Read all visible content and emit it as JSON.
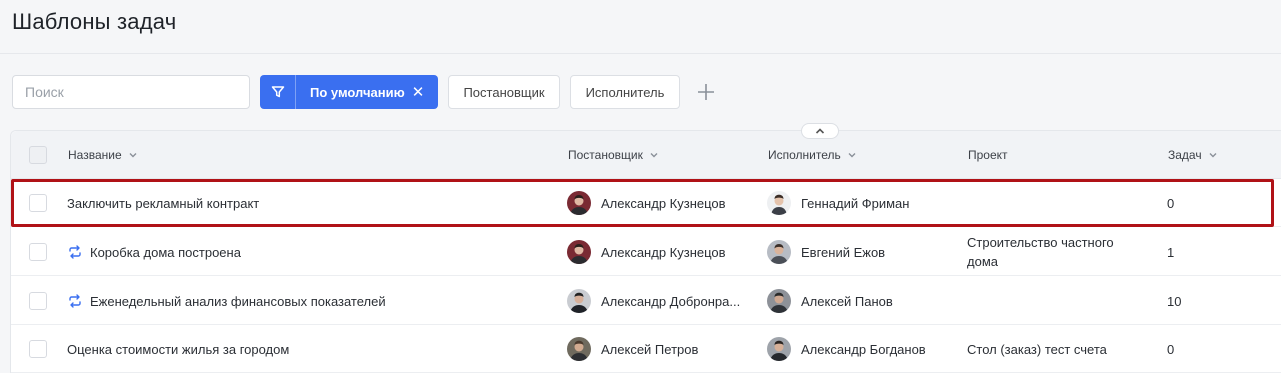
{
  "page": {
    "title": "Шаблоны задач"
  },
  "search": {
    "placeholder": "Поиск",
    "value": ""
  },
  "filters": {
    "default_label": "По умолчанию",
    "author_label": "Постановщик",
    "executor_label": "Исполнитель"
  },
  "table": {
    "columns": {
      "name": "Название",
      "author": "Постановщик",
      "executor": "Исполнитель",
      "project": "Проект",
      "tasks": "Задач"
    },
    "rows": [
      {
        "name": "Заключить рекламный контракт",
        "recurring": false,
        "author": "Александр Кузнецов",
        "executor": "Геннадий Фриман",
        "project": "",
        "tasks": "0"
      },
      {
        "name": "Коробка дома построена",
        "recurring": true,
        "author": "Александр Кузнецов",
        "executor": "Евгений Ежов",
        "project": "Строительство частного дома",
        "tasks": "1"
      },
      {
        "name": "Еженедельный анализ финансовых показателей",
        "recurring": true,
        "author": "Александр Добронра...",
        "executor": "Алексей Панов",
        "project": "",
        "tasks": "10"
      },
      {
        "name": "Оценка стоимости жилья за городом",
        "recurring": false,
        "author": "Алексей Петров",
        "executor": "Александр Богданов",
        "project": "Стол (заказ) тест счета",
        "tasks": "0"
      }
    ]
  },
  "icons": {
    "filter": "funnel-icon",
    "remove_filter": "close-icon",
    "add_filter": "plus-icon",
    "sort": "chevron-down-icon",
    "collapse": "chevron-up-icon",
    "recurring": "repeat-icon"
  },
  "colors": {
    "accent": "#3a6ff0",
    "highlight": "#b01217",
    "recurring_icon": "#3a6ff0"
  }
}
